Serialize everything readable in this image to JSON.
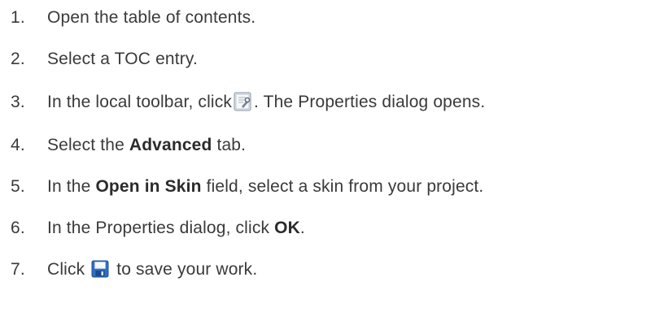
{
  "steps": [
    {
      "number": "1.",
      "text": "Open the table of contents."
    },
    {
      "number": "2.",
      "text": "Select a TOC entry."
    },
    {
      "number": "3.",
      "before": "In the local toolbar, click",
      "icon": "properties-icon",
      "after": ". The Properties dialog opens."
    },
    {
      "number": "4.",
      "before": "Select the ",
      "bold": "Advanced",
      "after": " tab."
    },
    {
      "number": "5.",
      "before": "In the ",
      "bold": "Open in Skin",
      "after": " field, select a skin from your project."
    },
    {
      "number": "6.",
      "before": "In the Properties dialog, click ",
      "bold": "OK",
      "after": "."
    },
    {
      "number": "7.",
      "before": "Click ",
      "icon": "save-icon",
      "after": " to save your work."
    }
  ]
}
